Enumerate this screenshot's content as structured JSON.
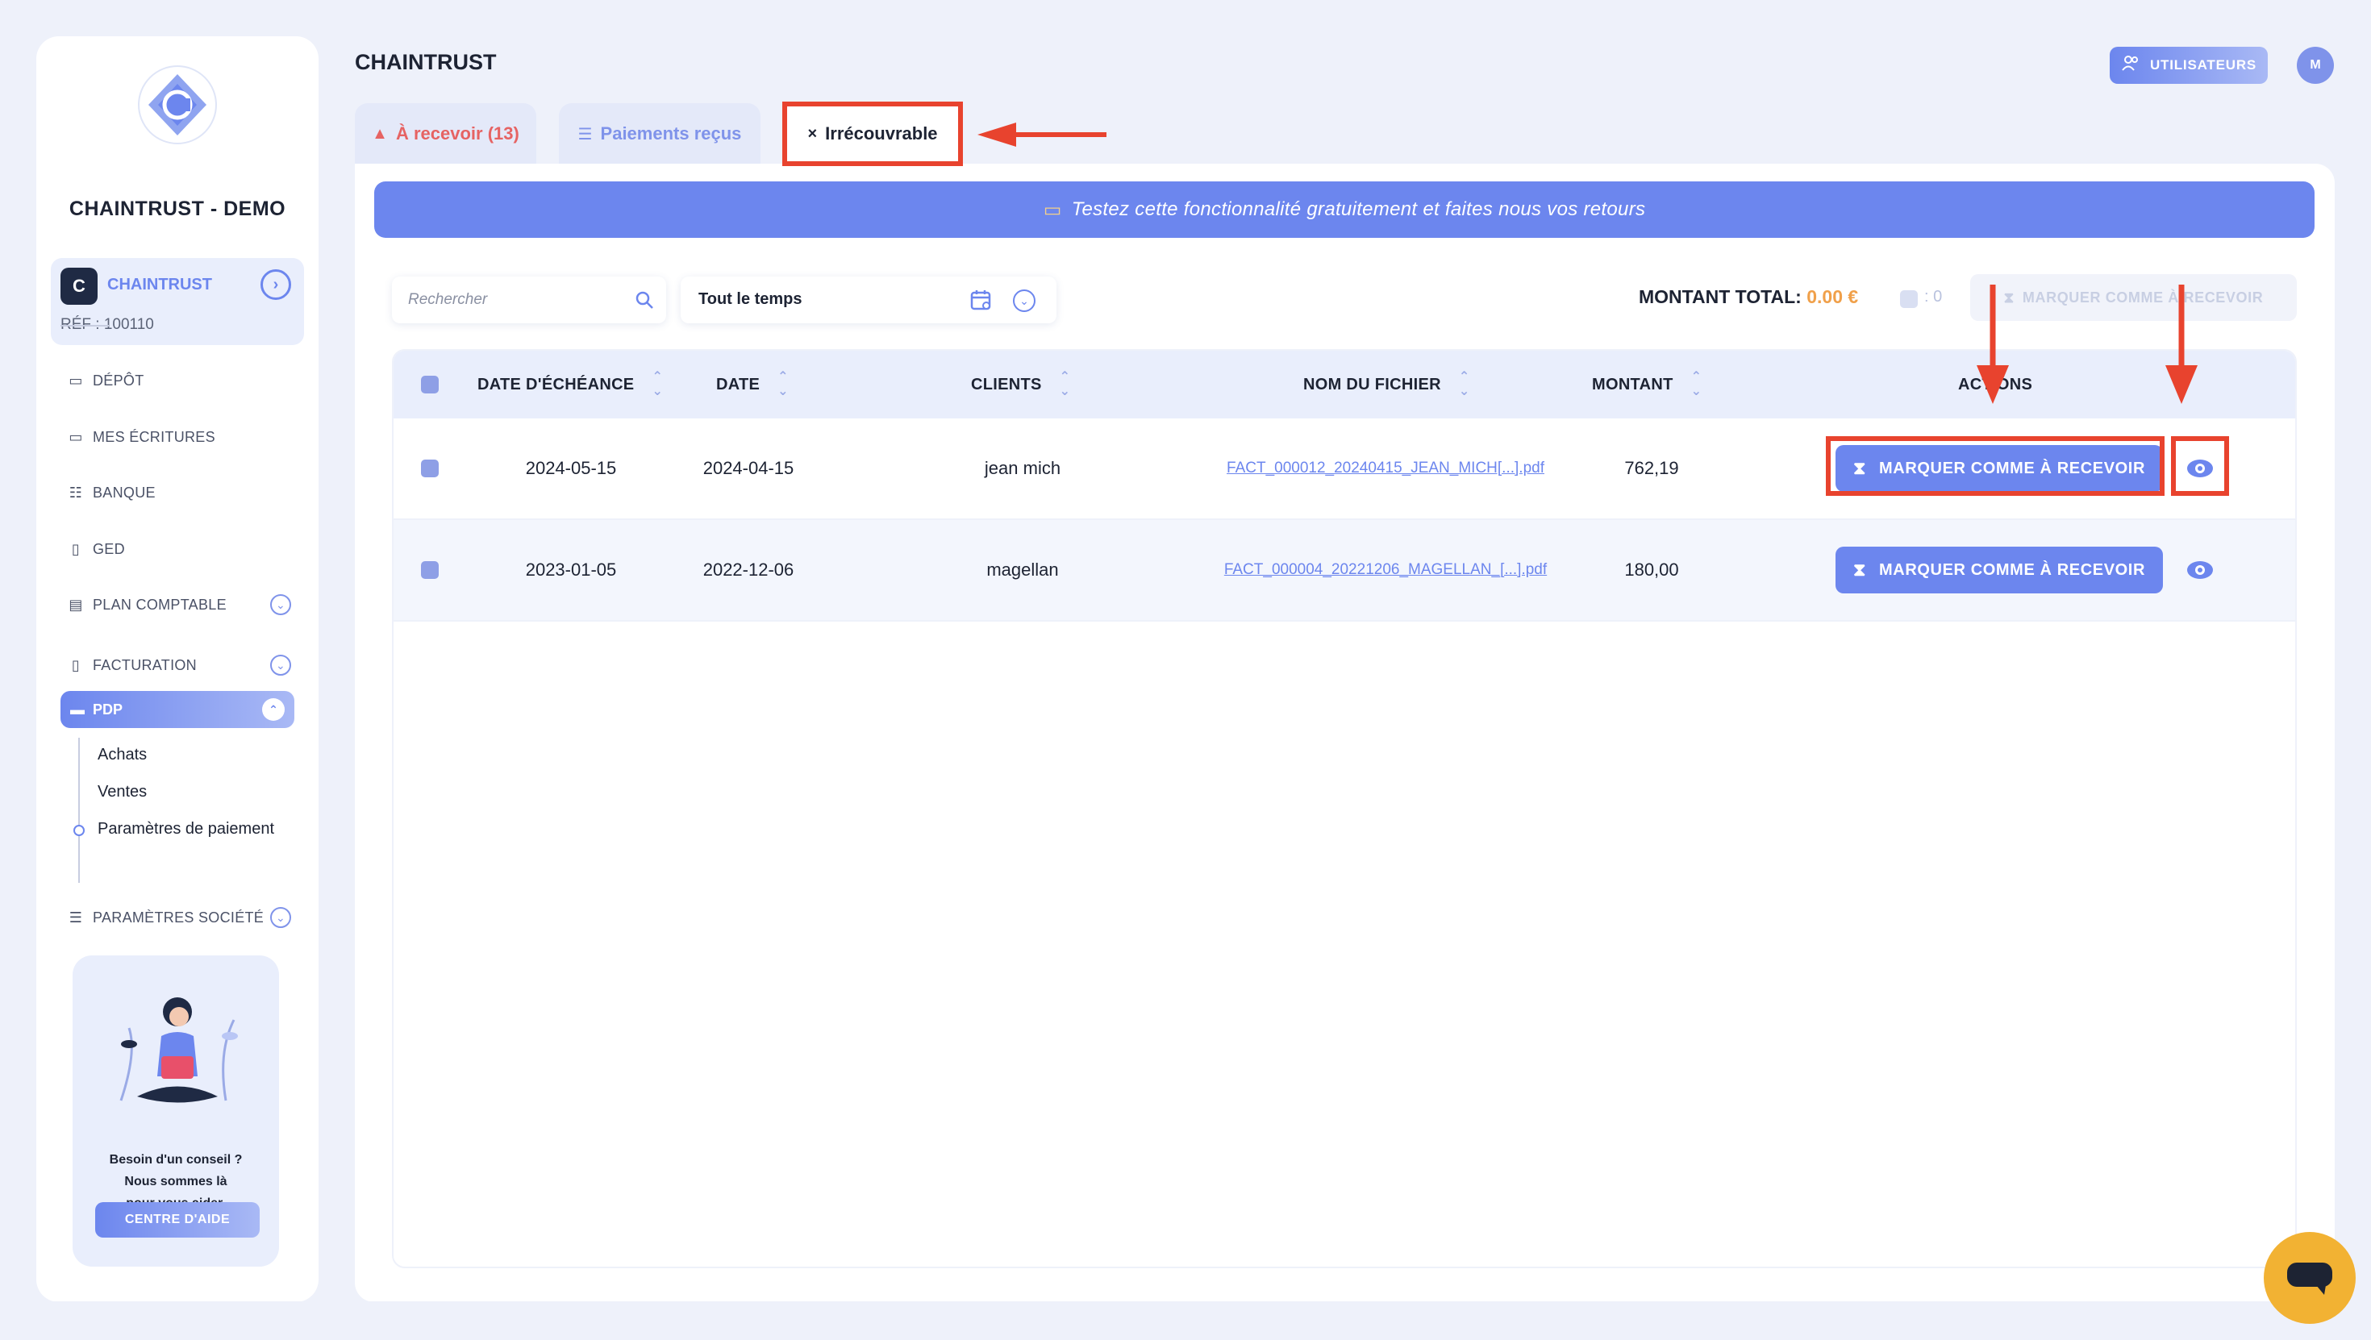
{
  "sidebar": {
    "company_name": "CHAINTRUST - DEMO",
    "account": {
      "avatar": "C",
      "name": "CHAINTRUST",
      "ref": "RÉF : 100110"
    },
    "items": [
      {
        "label": "DÉPÔT",
        "icon": "upload-icon"
      },
      {
        "label": "MES ÉCRITURES",
        "icon": "folder-icon"
      },
      {
        "label": "BANQUE",
        "icon": "bank-icon"
      },
      {
        "label": "GED",
        "icon": "document-icon"
      },
      {
        "label": "PLAN COMPTABLE",
        "icon": "list-icon"
      },
      {
        "label": "FACTURATION",
        "icon": "invoice-icon"
      },
      {
        "label": "PDP",
        "icon": "card-icon"
      },
      {
        "label": "PARAMÈTRES SOCIÉTÉ",
        "icon": "sliders-icon"
      }
    ],
    "subitems": [
      {
        "label": "Achats"
      },
      {
        "label": "Ventes"
      },
      {
        "label": "Paramètres de paiement"
      }
    ],
    "help": {
      "line1": "Besoin d'un conseil ?",
      "line2": "Nous sommes là",
      "line3": "pour vous aider.",
      "button": "CENTRE D'AIDE"
    }
  },
  "header": {
    "title": "CHAINTRUST",
    "users_button": "UTILISATEURS",
    "avatar": "M"
  },
  "tabs": [
    {
      "label": "À recevoir (13)",
      "icon": "warning-icon"
    },
    {
      "label": "Paiements reçus",
      "icon": "payment-icon"
    },
    {
      "label": "Irrécouvrable",
      "icon": "close-icon",
      "active": true
    }
  ],
  "banner": {
    "text": "Testez cette fonctionnalité gratuitement et faites nous vos retours"
  },
  "filters": {
    "search_placeholder": "Rechercher",
    "period": "Tout le temps"
  },
  "summary": {
    "total_label": "MONTANT TOTAL:",
    "total_value": "0.00 €",
    "selected_count": ": 0",
    "bulk_button": "MARQUER COMME À RECEVOIR"
  },
  "table": {
    "columns": [
      "DATE D'ÉCHÉANCE",
      "DATE",
      "CLIENTS",
      "NOM DU FICHIER",
      "MONTANT",
      "ACTIONS"
    ],
    "rows": [
      {
        "due_date": "2024-05-15",
        "date": "2024-04-15",
        "client": "jean mich",
        "file": "FACT_000012_20240415_JEAN_MICH[...].pdf",
        "amount": "762,19",
        "action": "MARQUER COMME À RECEVOIR"
      },
      {
        "due_date": "2023-01-05",
        "date": "2022-12-06",
        "client": "magellan",
        "file": "FACT_000004_20221206_MAGELLAN_[...].pdf",
        "amount": "180,00",
        "action": "MARQUER COMME À RECEVOIR"
      }
    ]
  },
  "colors": {
    "accent": "#6c86ee",
    "annotation": "#e8432e",
    "warning": "#e66363",
    "total": "#f0a04a",
    "chat": "#f2b233"
  }
}
